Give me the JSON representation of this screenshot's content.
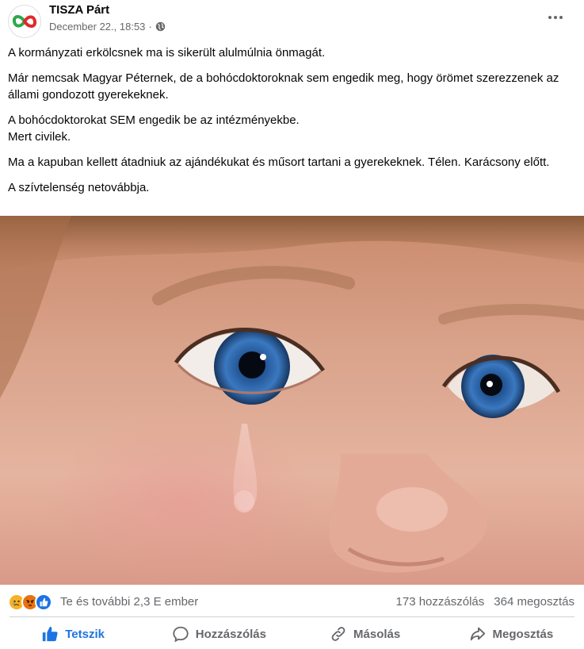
{
  "post": {
    "author": "TISZA Párt",
    "date": "December 22., 18:53",
    "separator": "·",
    "paragraphs": [
      "A kormányzati erkölcsnek ma is sikerült alulmúlnia önmagát.",
      "Már nemcsak Magyar Péternek, de a bohócdoktoroknak sem engedik meg, hogy örömet szerezzenek az állami gondozott gyerekeknek.",
      "A bohócdoktorokat SEM engedik be az intézményekbe.",
      "Mert civilek.",
      "Ma a kapuban kellett átadniuk az ajándékukat és műsort tartani a gyerekeknek. Télen. Karácsony előtt.",
      "A szívtelenség netovábbja."
    ]
  },
  "stats": {
    "reactions_text": "Te és további 2,3 E ember",
    "comments": "173 hozzászólás",
    "shares": "364 megosztás",
    "reaction_icons": [
      "sad-icon",
      "angry-icon",
      "like-icon"
    ]
  },
  "actions": {
    "like": "Tetszik",
    "comment": "Hozzászólás",
    "copy": "Másolás",
    "share": "Megosztás"
  },
  "colors": {
    "like_blue": "#1b74e4",
    "secondary_text": "#65676b",
    "brand_green": "#2ea84a",
    "brand_red": "#e0292b"
  }
}
